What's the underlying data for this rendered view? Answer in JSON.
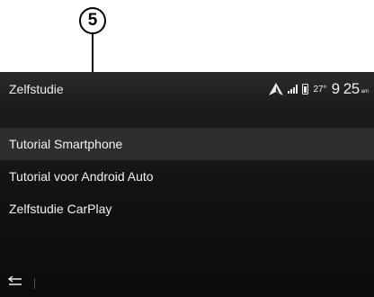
{
  "callout": {
    "number": "5"
  },
  "header": {
    "title": "Zelfstudie"
  },
  "status": {
    "navigation_icon": "navigation-arrow-icon",
    "signal_icon": "signal-bars-icon",
    "phone_icon": "phone-battery-icon",
    "temperature": "27°",
    "time": "9 25",
    "time_suffix": "am"
  },
  "menu": {
    "items": [
      {
        "label": "Tutorial Smartphone",
        "selected": true
      },
      {
        "label": "Tutorial voor Android Auto",
        "selected": false
      },
      {
        "label": "Zelfstudie CarPlay",
        "selected": false
      }
    ]
  },
  "footer": {
    "back_icon": "back-arrow-icon"
  },
  "colors": {
    "screen_bg": "#141414",
    "header_bg": "#242424",
    "selected_bg": "#2e2e2e",
    "text": "#f2f2f2"
  }
}
